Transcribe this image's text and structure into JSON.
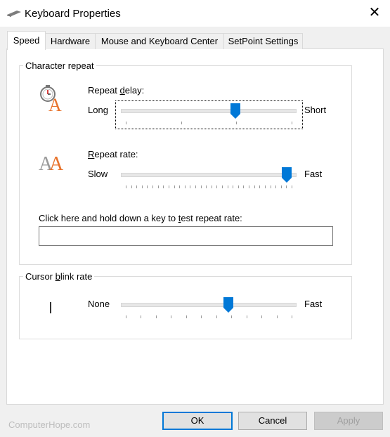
{
  "window": {
    "title": "Keyboard Properties",
    "icon": "keyboard-icon"
  },
  "tabs": [
    {
      "label": "Speed",
      "active": true
    },
    {
      "label": "Hardware"
    },
    {
      "label": "Mouse and Keyboard Center"
    },
    {
      "label": "SetPoint Settings"
    }
  ],
  "character_repeat": {
    "group_title": "Character repeat",
    "repeat_delay": {
      "label_pre": "Repeat ",
      "label_ul": "d",
      "label_post": "elay:",
      "min_label": "Long",
      "max_label": "Short",
      "value_fraction": 0.66,
      "tick_count": 4
    },
    "repeat_rate": {
      "label_pre": "",
      "label_ul": "R",
      "label_post": "epeat rate:",
      "min_label": "Slow",
      "max_label": "Fast",
      "value_fraction": 0.97,
      "tick_count": 32
    },
    "test_label_pre": "Click here and hold down a key to ",
    "test_label_ul": "t",
    "test_label_post": "est repeat rate:",
    "test_value": ""
  },
  "cursor_blink": {
    "group_title_pre": "Cursor ",
    "group_title_ul": "b",
    "group_title_post": "link rate",
    "min_label": "None",
    "max_label": "Fast",
    "value_fraction": 0.62,
    "tick_count": 12
  },
  "buttons": {
    "ok": "OK",
    "cancel": "Cancel",
    "apply": "Apply"
  },
  "watermark": "ComputerHope.com",
  "colors": {
    "accent": "#0078d7",
    "icon_orange": "#e8732c",
    "icon_grey": "#9a9a9a"
  }
}
